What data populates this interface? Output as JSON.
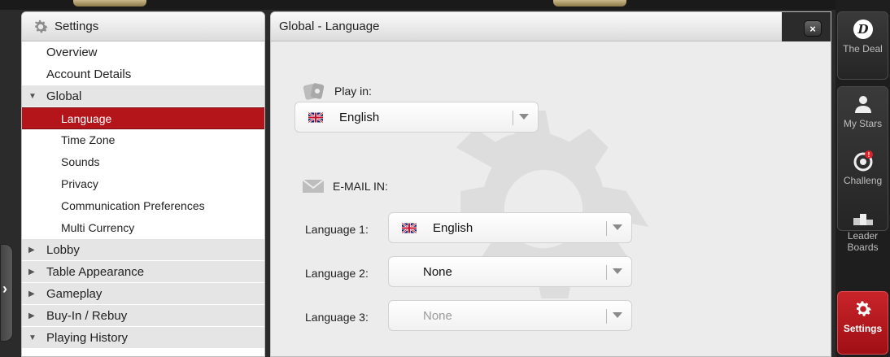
{
  "left_panel": {
    "title": "Settings",
    "items": [
      {
        "label": "Overview",
        "level": 0,
        "kind": "plain"
      },
      {
        "label": "Account Details",
        "level": 0,
        "kind": "plain"
      },
      {
        "label": "Global",
        "level": 0,
        "kind": "expanded"
      },
      {
        "label": "Language",
        "level": 1,
        "kind": "selected"
      },
      {
        "label": "Time Zone",
        "level": 1,
        "kind": "plain"
      },
      {
        "label": "Sounds",
        "level": 1,
        "kind": "plain"
      },
      {
        "label": "Privacy",
        "level": 1,
        "kind": "plain"
      },
      {
        "label": "Communication Preferences",
        "level": 1,
        "kind": "plain"
      },
      {
        "label": "Multi Currency",
        "level": 1,
        "kind": "plain"
      },
      {
        "label": "Lobby",
        "level": 0,
        "kind": "collapsed"
      },
      {
        "label": "Table Appearance",
        "level": 0,
        "kind": "collapsed"
      },
      {
        "label": "Gameplay",
        "level": 0,
        "kind": "collapsed"
      },
      {
        "label": "Buy-In / Rebuy",
        "level": 0,
        "kind": "collapsed"
      },
      {
        "label": "Playing History",
        "level": 0,
        "kind": "expanded"
      }
    ]
  },
  "right_panel": {
    "title": "Global - Language",
    "close_label": "×",
    "play_in": {
      "label": "Play in:",
      "value": "English",
      "flag": "uk-flag-icon"
    },
    "email_in": {
      "label": "E-MAIL IN:",
      "fields": [
        {
          "label": "Language 1:",
          "value": "English",
          "flag": "uk-flag-icon",
          "muted": false
        },
        {
          "label": "Language 2:",
          "value": "None",
          "flag": "",
          "muted": false
        },
        {
          "label": "Language 3:",
          "value": "None",
          "flag": "",
          "muted": true
        }
      ]
    }
  },
  "rail": {
    "items": [
      {
        "label": "The Deal",
        "icon": "deal-logo-icon",
        "active": false
      },
      {
        "label": "My Stars",
        "icon": "person-icon",
        "active": false
      },
      {
        "label": "Challeng",
        "icon": "target-icon",
        "active": false
      },
      {
        "label": "Leader Boards",
        "icon": "podium-icon",
        "active": false
      },
      {
        "label": "Settings",
        "icon": "gear-icon",
        "active": true
      }
    ]
  },
  "colors": {
    "accent": "#b3151b",
    "panel_bg": "#ececec",
    "frame_bg": "#2b2b2b"
  }
}
